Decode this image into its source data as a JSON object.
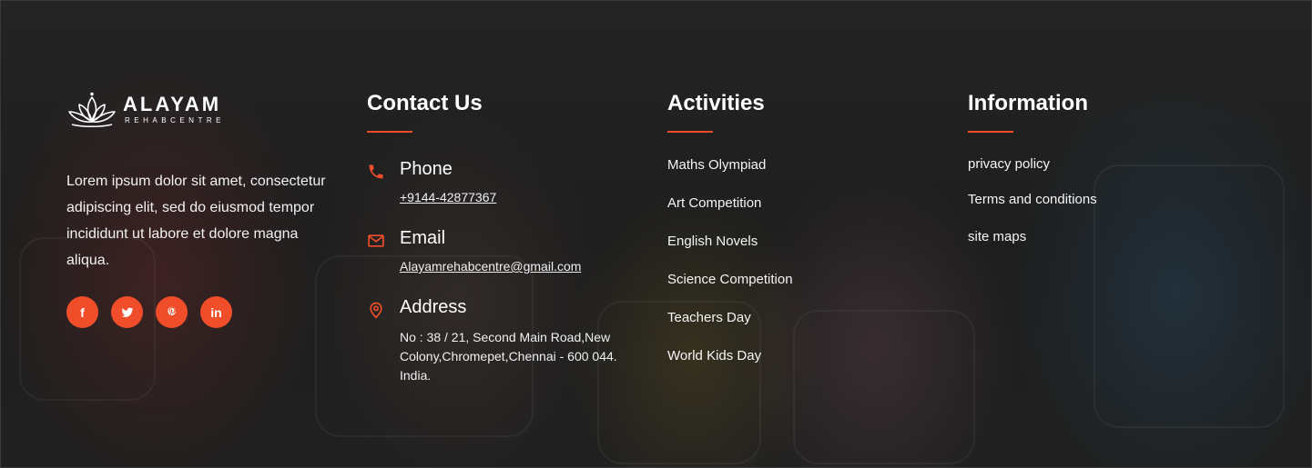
{
  "brand": {
    "name": "ALAYAM",
    "subtitle": "REHABCENTRE",
    "accent_color": "#f04e2b"
  },
  "about": {
    "text": "Lorem ipsum dolor sit amet, consectetur adipiscing elit, sed do eiusmod tempor incididunt ut labore et dolore magna aliqua."
  },
  "socials": [
    {
      "icon": "facebook-icon",
      "glyph": "f"
    },
    {
      "icon": "twitter-icon",
      "glyph": ""
    },
    {
      "icon": "pinterest-icon",
      "glyph": "P"
    },
    {
      "icon": "linkedin-icon",
      "glyph": "in"
    }
  ],
  "contact": {
    "heading": "Contact Us",
    "phone": {
      "title": "Phone",
      "value": "+9144-42877367",
      "icon": "phone-icon"
    },
    "email": {
      "title": "Email",
      "value": "Alayamrehabcentre@gmail.com",
      "icon": "mail-icon"
    },
    "address": {
      "title": "Address",
      "value": "No : 38 / 21, Second Main Road,New Colony,Chromepet,Chennai - 600 044. India.",
      "icon": "map-pin-icon"
    }
  },
  "activities": {
    "heading": "Activities",
    "items": [
      "Maths Olympiad",
      "Art Competition",
      "English Novels",
      "Science Competition",
      "Teachers Day",
      "World Kids Day"
    ]
  },
  "information": {
    "heading": "Information",
    "items": [
      "privacy policy",
      "Terms and conditions",
      "site maps"
    ]
  }
}
